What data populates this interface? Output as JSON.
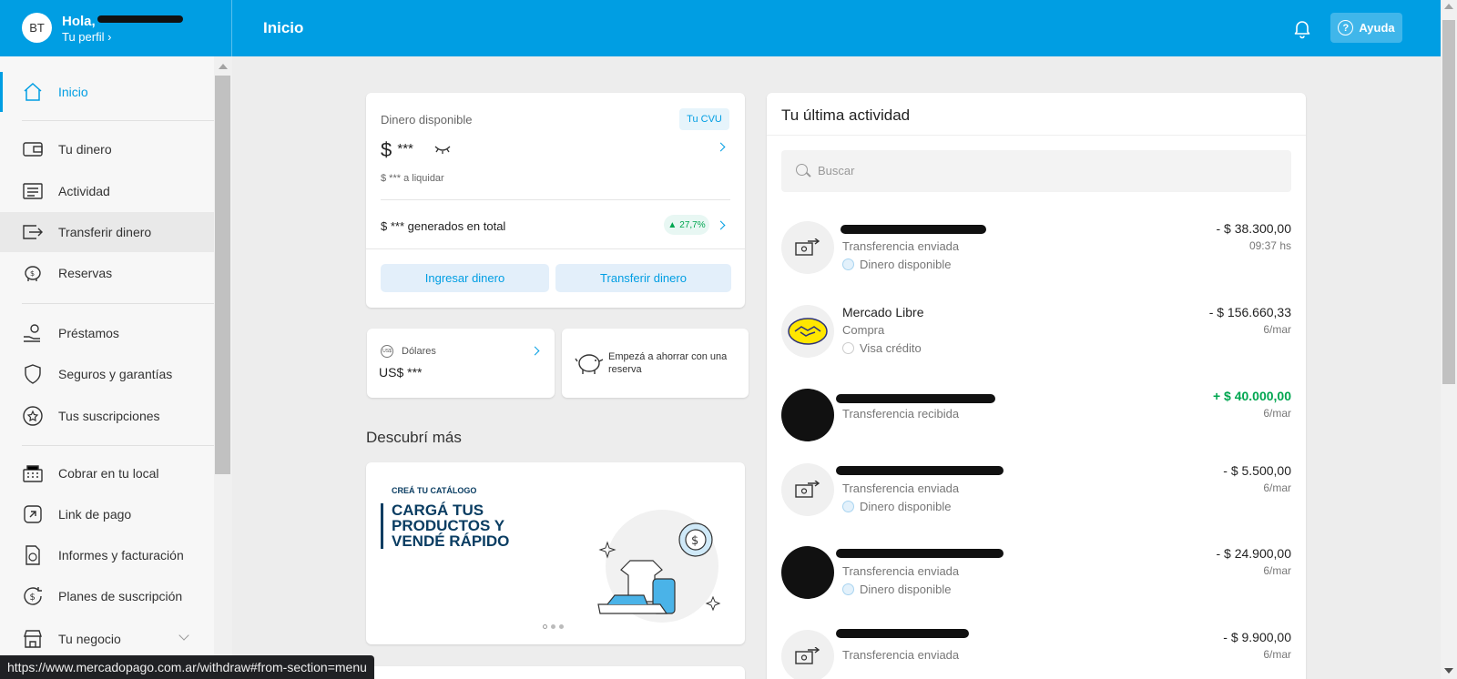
{
  "header": {
    "avatar_initials": "BT",
    "greeting": "Hola,",
    "profile_link": "Tu perfil ›",
    "title": "Inicio",
    "help_label": "Ayuda",
    "help_glyph": "?"
  },
  "sidebar": {
    "items": [
      {
        "label": "Inicio",
        "icon": "home-icon"
      },
      {
        "label": "Tu dinero",
        "icon": "wallet-icon"
      },
      {
        "label": "Actividad",
        "icon": "activity-icon"
      },
      {
        "label": "Transferir dinero",
        "icon": "transfer-icon"
      },
      {
        "label": "Reservas",
        "icon": "piggy-bank-icon"
      },
      {
        "label": "Préstamos",
        "icon": "loan-icon"
      },
      {
        "label": "Seguros y garantías",
        "icon": "shield-icon"
      },
      {
        "label": "Tus suscripciones",
        "icon": "star-icon"
      },
      {
        "label": "Cobrar en tu local",
        "icon": "register-icon"
      },
      {
        "label": "Link de pago",
        "icon": "link-icon"
      },
      {
        "label": "Informes y facturación",
        "icon": "report-icon"
      },
      {
        "label": "Planes de suscripción",
        "icon": "subscription-plan-icon"
      },
      {
        "label": "Tu negocio",
        "icon": "store-icon"
      }
    ]
  },
  "status_url": "https://www.mercadopago.com.ar/withdraw#from-section=menu",
  "money": {
    "label": "Dinero disponible",
    "cvu": "Tu CVU",
    "amount_currency": "$",
    "amount_hidden": "***",
    "pending": "$ *** a liquidar",
    "generated": "$ *** generados en total",
    "pct_arrow": "▲",
    "pct": "27,7%",
    "deposit_button": "Ingresar dinero",
    "transfer_button": "Transferir dinero"
  },
  "dollars": {
    "label": "Dólares",
    "icon_text": "US$",
    "amount": "US$ ***"
  },
  "savings": {
    "text": "Empezá a ahorrar con una reserva"
  },
  "discover": {
    "title": "Descubrí más",
    "eyebrow": "CREÁ TU CATÁLOGO",
    "headline": "CARGÁ TUS PRODUCTOS Y VENDÉ RÁPIDO",
    "illustration_glyph": "$"
  },
  "activity": {
    "title": "Tu última actividad",
    "search_placeholder": "Buscar",
    "rows": [
      {
        "name": "",
        "type": "Transferencia enviada",
        "method": "Dinero disponible",
        "amount": "- $ 38.300,00",
        "date": "09:37 hs"
      },
      {
        "name": "Mercado Libre",
        "type": "Compra",
        "method": "Visa crédito",
        "amount": "- $ 156.660,33",
        "date": "6/mar"
      },
      {
        "name": "",
        "type": "Transferencia recibida",
        "method": "",
        "amount": "+ $ 40.000,00",
        "date": "6/mar"
      },
      {
        "name": "",
        "type": "Transferencia enviada",
        "method": "Dinero disponible",
        "amount": "- $ 5.500,00",
        "date": "6/mar"
      },
      {
        "name": "",
        "type": "Transferencia enviada",
        "method": "Dinero disponible",
        "amount": "- $ 24.900,00",
        "date": "6/mar"
      },
      {
        "name": "",
        "type": "Transferencia enviada",
        "method": "",
        "amount": "- $ 9.900,00",
        "date": "6/mar"
      }
    ]
  },
  "colors": {
    "brand": "#009ee3",
    "positive": "#00a650",
    "text": "#333333"
  }
}
